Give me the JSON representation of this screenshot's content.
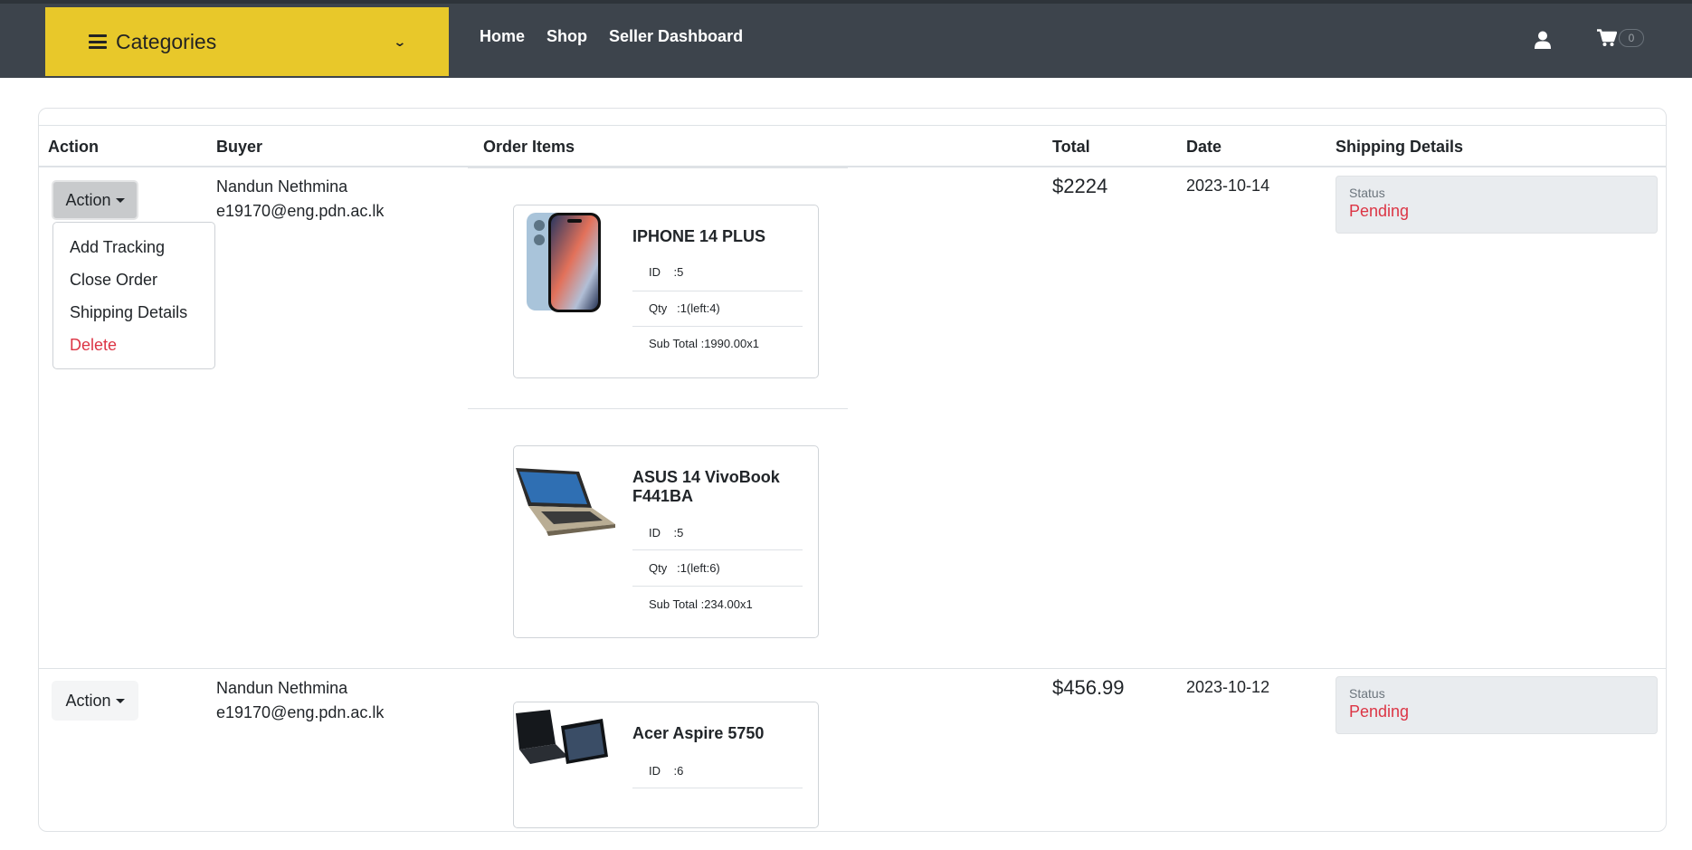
{
  "header": {
    "categories_label": "Categories",
    "nav": [
      "Home",
      "Shop",
      "Seller Dashboard"
    ],
    "cart_count": "0"
  },
  "table": {
    "columns": [
      "Action",
      "Buyer",
      "Order Items",
      "Total",
      "Date",
      "Shipping Details"
    ]
  },
  "action_menu": {
    "button_label": "Action",
    "items": [
      "Add Tracking",
      "Close Order",
      "Shipping Details",
      "Delete"
    ]
  },
  "orders": [
    {
      "buyer_name": "Nandun Nethmina",
      "buyer_email": "e19170@eng.pdn.ac.lk",
      "total": "$2224",
      "date": "2023-10-14",
      "status_label": "Status",
      "status": "Pending",
      "items": [
        {
          "name": "IPHONE 14 PLUS",
          "id_label": "ID",
          "id": ":5",
          "qty_label": "Qty",
          "qty": ":1(left:4)",
          "subtotal_label": "Sub Total",
          "subtotal": ":1990.00x1"
        },
        {
          "name": "ASUS 14 VivoBook F441BA",
          "id_label": "ID",
          "id": ":5",
          "qty_label": "Qty",
          "qty": ":1(left:6)",
          "subtotal_label": "Sub Total",
          "subtotal": ":234.00x1"
        }
      ]
    },
    {
      "buyer_name": "Nandun Nethmina",
      "buyer_email": "e19170@eng.pdn.ac.lk",
      "total": "$456.99",
      "date": "2023-10-12",
      "status_label": "Status",
      "status": "Pending",
      "items": [
        {
          "name": "Acer Aspire 5750",
          "id_label": "ID",
          "id": ":6"
        }
      ]
    }
  ],
  "colors": {
    "topbar": "#3d444c",
    "category_yellow": "#e8c82a",
    "status_pending": "#dc3545"
  }
}
